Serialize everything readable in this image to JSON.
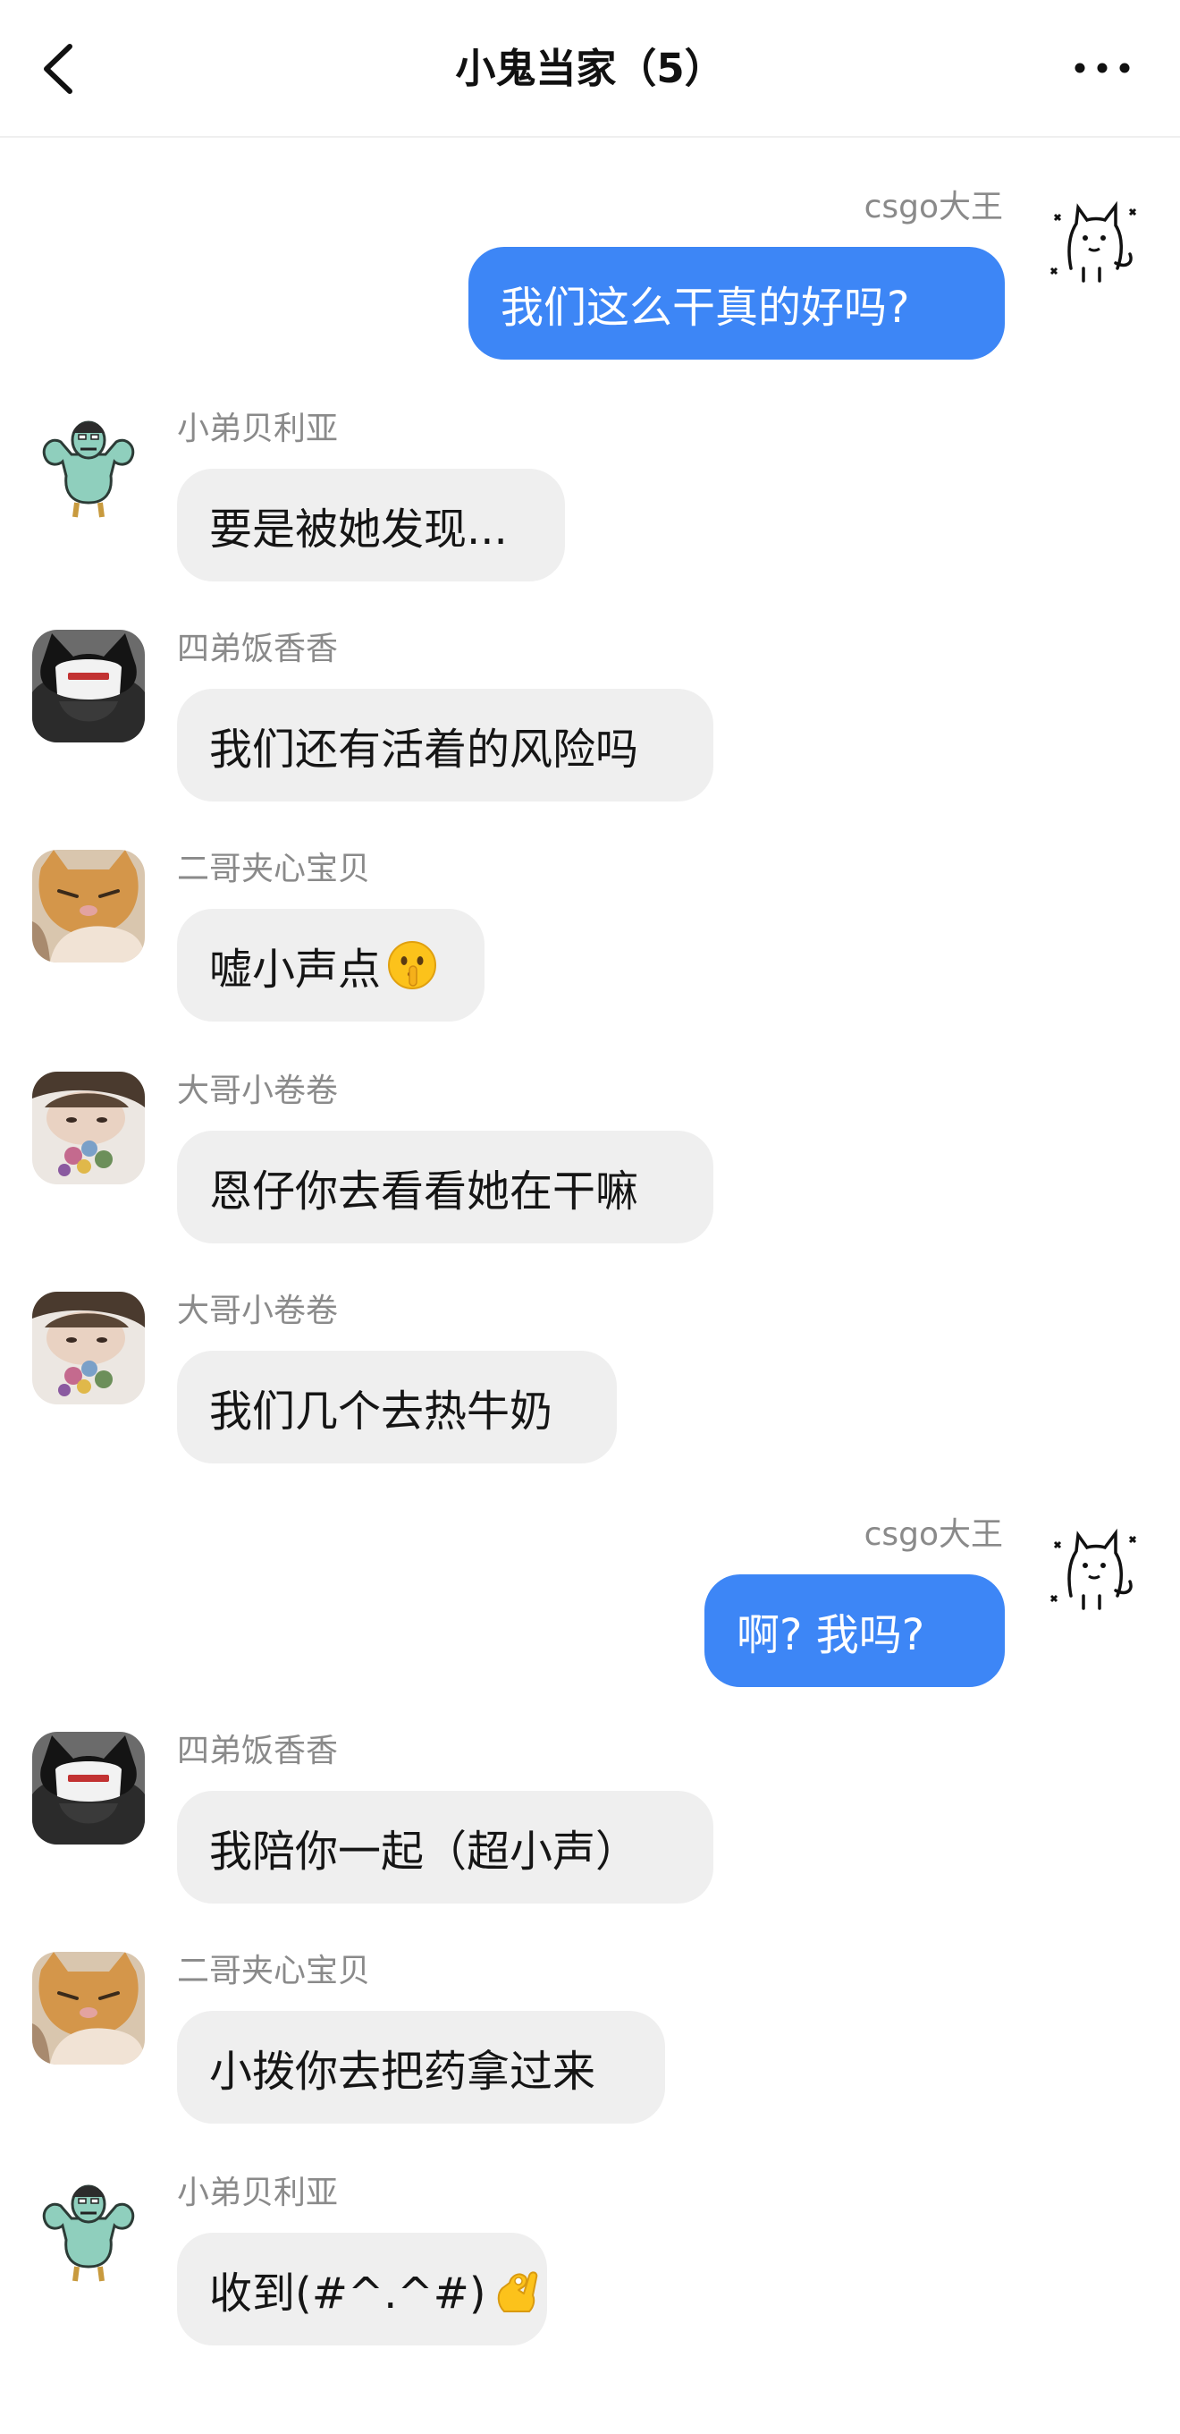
{
  "header": {
    "title": "小鬼当家（5）",
    "back_icon": "chevron-left-icon",
    "more_icon": "ellipsis-icon"
  },
  "colors": {
    "outgoing_bubble": "#3d86f6",
    "incoming_bubble": "#efefef",
    "sender_name": "#8a8a8a"
  },
  "messages": [
    {
      "direction": "outgoing",
      "sender": "csgo大王",
      "text": "我们这么干真的好吗?",
      "avatar": "doodle-cat-avatar"
    },
    {
      "direction": "incoming",
      "sender": "小弟贝利亚",
      "text": "要是被她发现...",
      "avatar": "muscle-cartoon-avatar"
    },
    {
      "direction": "incoming",
      "sender": "四弟饭香香",
      "text": "我们还有活着的风险吗",
      "avatar": "cat-ear-cap-avatar"
    },
    {
      "direction": "incoming",
      "sender": "二哥夹心宝贝",
      "text": "嘘小声点",
      "emoji": "shushing-face-emoji",
      "avatar": "orange-cat-avatar"
    },
    {
      "direction": "incoming",
      "sender": "大哥小卷卷",
      "text": "恩仔你去看看她在干嘛",
      "avatar": "girl-flowers-avatar"
    },
    {
      "direction": "incoming",
      "sender": "大哥小卷卷",
      "text": "我们几个去热牛奶",
      "avatar": "girl-flowers-avatar"
    },
    {
      "direction": "outgoing",
      "sender": "csgo大王",
      "text": "啊? 我吗?",
      "avatar": "doodle-cat-avatar"
    },
    {
      "direction": "incoming",
      "sender": "四弟饭香香",
      "text": "我陪你一起（超小声）",
      "avatar": "cat-ear-cap-avatar"
    },
    {
      "direction": "incoming",
      "sender": "二哥夹心宝贝",
      "text": "小拨你去把药拿过来",
      "avatar": "orange-cat-avatar"
    },
    {
      "direction": "incoming",
      "sender": "小弟贝利亚",
      "text": "收到(#^.^#)",
      "emoji": "ok-hand-emoji",
      "avatar": "muscle-cartoon-avatar"
    }
  ]
}
